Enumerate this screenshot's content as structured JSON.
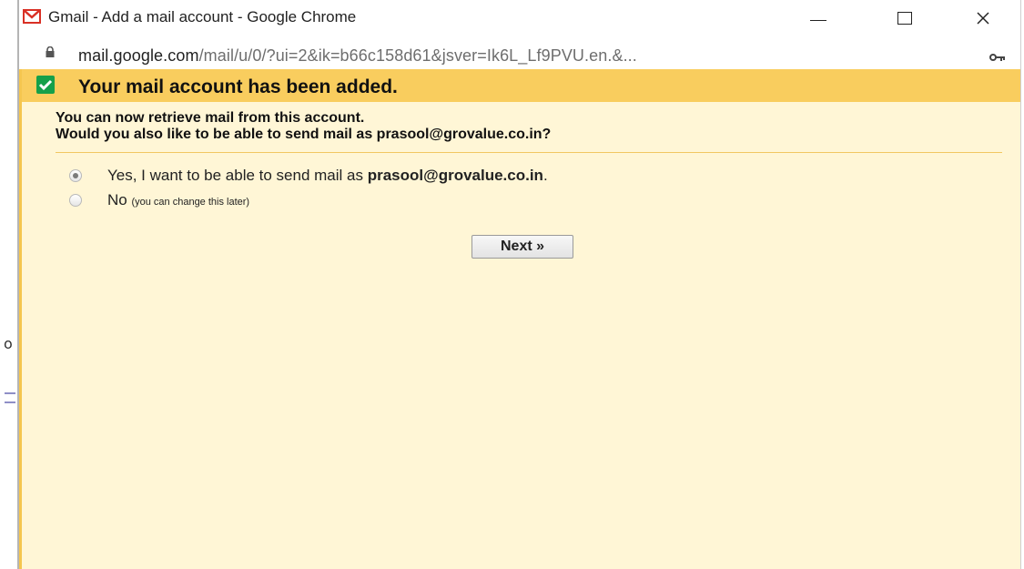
{
  "window": {
    "title": "Gmail - Add a mail account - Google Chrome",
    "controls": {
      "minimize_icon": "minimize-icon",
      "maximize_icon": "maximize-icon",
      "close_icon": "close-icon",
      "close_label": "✕"
    }
  },
  "address_bar": {
    "url_host": "mail.google.com",
    "url_path": "/mail/u/0/?ui=2&ik=b66c158d61&jsver=Ik6L_Lf9PVU.en.&...",
    "lock_icon": "lock-icon",
    "key_icon": "key-icon"
  },
  "banner": {
    "title": "Your mail account has been added.",
    "icon": "checkmark-icon",
    "color": "#f9cd5e"
  },
  "message": {
    "line1": "You can now retrieve mail from this account.",
    "line2": "Would you also like to be able to send mail as prasool@grovalue.co.in?"
  },
  "options": {
    "yes": {
      "prefix": "Yes, I want to be able to send mail as ",
      "email": "prasool@grovalue.co.in",
      "suffix": ".",
      "selected": true
    },
    "no": {
      "label": "No",
      "note": "(you can change this later)",
      "selected": false
    }
  },
  "actions": {
    "next_label": "Next »"
  },
  "background": {
    "edge_char": "o"
  },
  "colors": {
    "content_bg": "#fff6d6",
    "banner_bg": "#f9cd5e",
    "check_green": "#15a04a",
    "gmail_red": "#d93025"
  }
}
